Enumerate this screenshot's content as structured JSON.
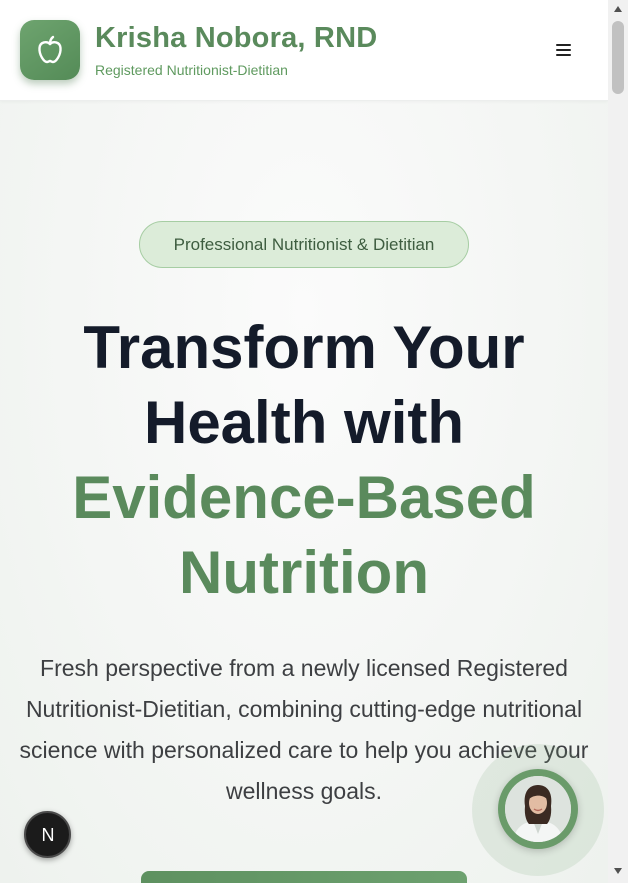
{
  "header": {
    "name": "Krisha Nobora, RND",
    "subtitle": "Registered Nutritionist-Dietitian",
    "logo_icon": "apple-icon",
    "menu_icon": "hamburger-menu-icon"
  },
  "hero": {
    "badge": "Professional Nutritionist & Dietitian",
    "headline_dark_1": "Transform Your",
    "headline_dark_2": "Health with",
    "headline_green_1": "Evidence-Based",
    "headline_green_2": "Nutrition",
    "lead": "Fresh perspective from a newly licensed Registered Nutritionist-Dietitian, combining cutting-edge nutritional science with personalized care to help you achieve your wellness goals."
  },
  "floating": {
    "dev_badge_letter": "N",
    "chat_avatar_icon": "nutritionist-avatar"
  },
  "colors": {
    "brand_green": "#5a8a5c",
    "headline_dark": "#141b2a",
    "badge_bg": "#dcecd9",
    "badge_border": "#a6cda3"
  }
}
